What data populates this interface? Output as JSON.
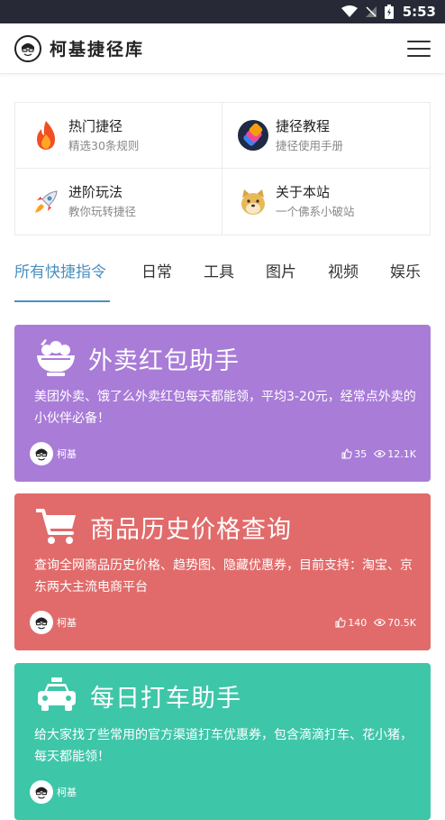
{
  "status_bar": {
    "time": "5:53"
  },
  "header": {
    "title": "柯基捷径库"
  },
  "quick_links": [
    {
      "title": "热门捷径",
      "subtitle": "精选30条规则",
      "icon": "fire-icon"
    },
    {
      "title": "捷径教程",
      "subtitle": "捷径使用手册",
      "icon": "shortcuts-app-icon"
    },
    {
      "title": "进阶玩法",
      "subtitle": "教你玩转捷径",
      "icon": "rocket-icon"
    },
    {
      "title": "关于本站",
      "subtitle": "一个佛系小破站",
      "icon": "doge-icon"
    }
  ],
  "tabs": [
    "所有快捷指令",
    "日常",
    "工具",
    "图片",
    "视频",
    "娱乐"
  ],
  "active_tab": 0,
  "cards": [
    {
      "title": "外卖红包助手",
      "description": "美团外卖、饿了么外卖红包每天都能领，平均3-20元，经常点外卖的小伙伴必备！",
      "author": "柯基",
      "likes": "35",
      "views": "12.1K",
      "color": "#a97cd8",
      "icon": "food-bowl-icon"
    },
    {
      "title": "商品历史价格查询",
      "description": "查询全网商品历史价格、趋势图、隐藏优惠券，目前支持：淘宝、京东两大主流电商平台",
      "author": "柯基",
      "likes": "140",
      "views": "70.5K",
      "color": "#e16b6b",
      "icon": "shopping-cart-icon"
    },
    {
      "title": "每日打车助手",
      "description": "给大家找了些常用的官方渠道打车优惠券，包含滴滴打车、花小猪，每天都能领！",
      "author": "柯基",
      "likes": "",
      "views": "",
      "color": "#3ec6a9",
      "icon": "taxi-icon"
    }
  ]
}
